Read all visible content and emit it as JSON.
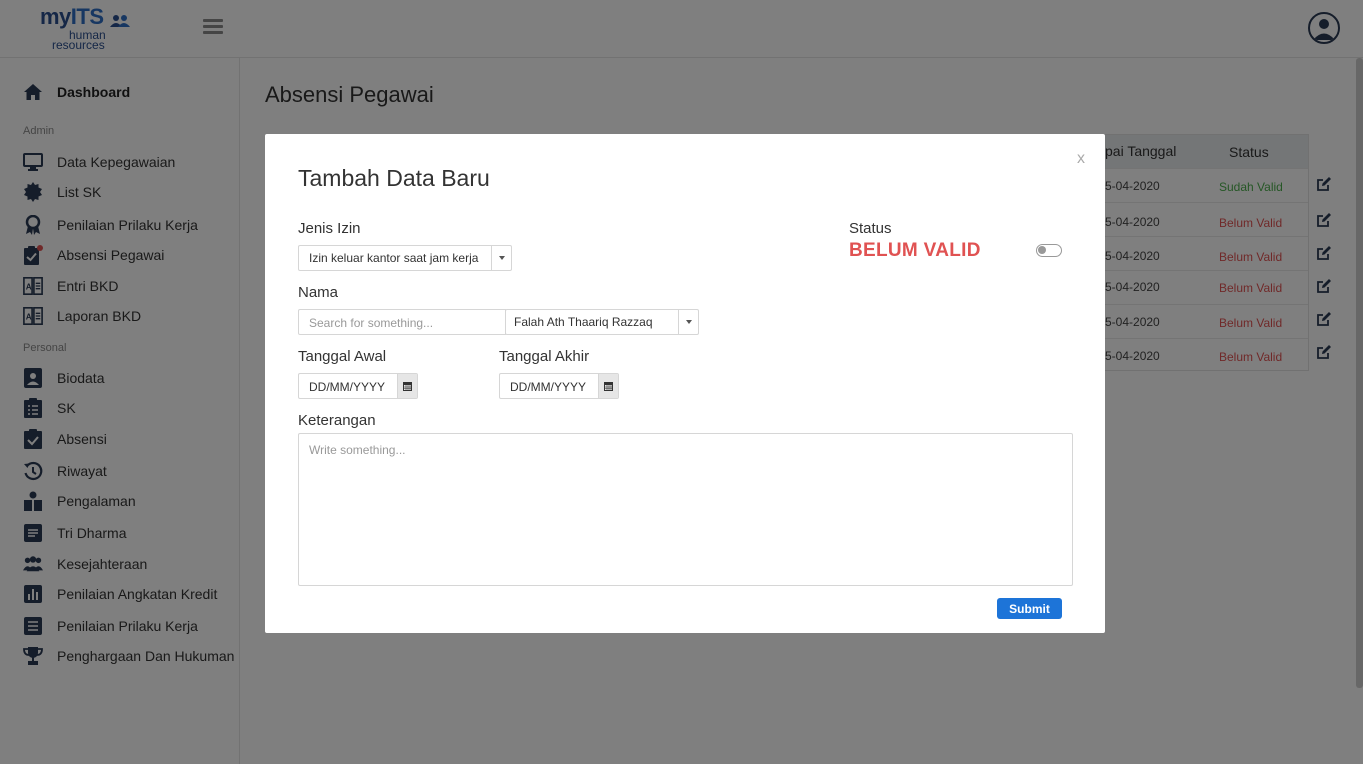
{
  "logo": {
    "my": "my",
    "its": "ITS",
    "line1": "human",
    "line2": "resources"
  },
  "sidebar": {
    "dashboard": "Dashboard",
    "admin_label": "Admin",
    "admin_items": [
      {
        "label": "Data Kepegawaian",
        "icon": "monitor-icon"
      },
      {
        "label": "List SK",
        "icon": "certificate-icon"
      },
      {
        "label": "Penilaian Prilaku Kerja",
        "icon": "award-icon"
      },
      {
        "label": "Absensi Pegawai",
        "icon": "clipboard-check-icon"
      },
      {
        "label": "Entri BKD",
        "icon": "book-icon"
      },
      {
        "label": "Laporan BKD",
        "icon": "book-icon"
      }
    ],
    "personal_label": "Personal",
    "personal_items": [
      {
        "label": "Biodata",
        "icon": "id-card-icon"
      },
      {
        "label": "SK",
        "icon": "clipboard-list-icon"
      },
      {
        "label": "Absensi",
        "icon": "clipboard-check-icon"
      },
      {
        "label": "Riwayat",
        "icon": "history-icon"
      },
      {
        "label": "Pengalaman",
        "icon": "briefcase-icon"
      },
      {
        "label": "Tri Dharma",
        "icon": "book-open-icon"
      },
      {
        "label": "Kesejahteraan",
        "icon": "users-icon"
      },
      {
        "label": "Penilaian Angkatan Kredit",
        "icon": "bar-chart-icon"
      },
      {
        "label": "Penilaian Prilaku Kerja",
        "icon": "file-text-icon"
      },
      {
        "label": "Penghargaan Dan Hukuman",
        "icon": "trophy-icon"
      }
    ]
  },
  "page": {
    "title": "Absensi Pegawai"
  },
  "table": {
    "headers": {
      "date": "pai Tanggal",
      "status": "Status"
    },
    "rows": [
      {
        "date": "5-04-2020",
        "status": "Sudah Valid",
        "valid": true
      },
      {
        "date": "5-04-2020",
        "status": "Belum Valid",
        "valid": false
      },
      {
        "date": "5-04-2020",
        "status": "Belum Valid",
        "valid": false
      },
      {
        "date": "5-04-2020",
        "status": "Belum Valid",
        "valid": false
      },
      {
        "date": "5-04-2020",
        "status": "Belum Valid",
        "valid": false
      },
      {
        "date": "5-04-2020",
        "status": "Belum Valid",
        "valid": false
      }
    ]
  },
  "modal": {
    "close": "x",
    "title": "Tambah Data Baru",
    "jenis_izin_label": "Jenis Izin",
    "jenis_izin_value": "Izin keluar kantor saat jam kerja",
    "status_label": "Status",
    "status_value": "BELUM VALID",
    "nama_label": "Nama",
    "nama_search_placeholder": "Search for something...",
    "nama_value": "Falah Ath Thaariq Razzaq",
    "tanggal_awal_label": "Tanggal Awal",
    "tanggal_awal_placeholder": "DD/MM/YYYY",
    "tanggal_akhir_label": "Tanggal Akhir",
    "tanggal_akhir_placeholder": "DD/MM/YYYY",
    "keterangan_label": "Keterangan",
    "keterangan_placeholder": "Write something...",
    "submit": "Submit"
  },
  "colors": {
    "valid": "#4cae4c",
    "invalid": "#e05252",
    "primary": "#1d74d8",
    "sidebar_icon": "#2b3b55"
  }
}
